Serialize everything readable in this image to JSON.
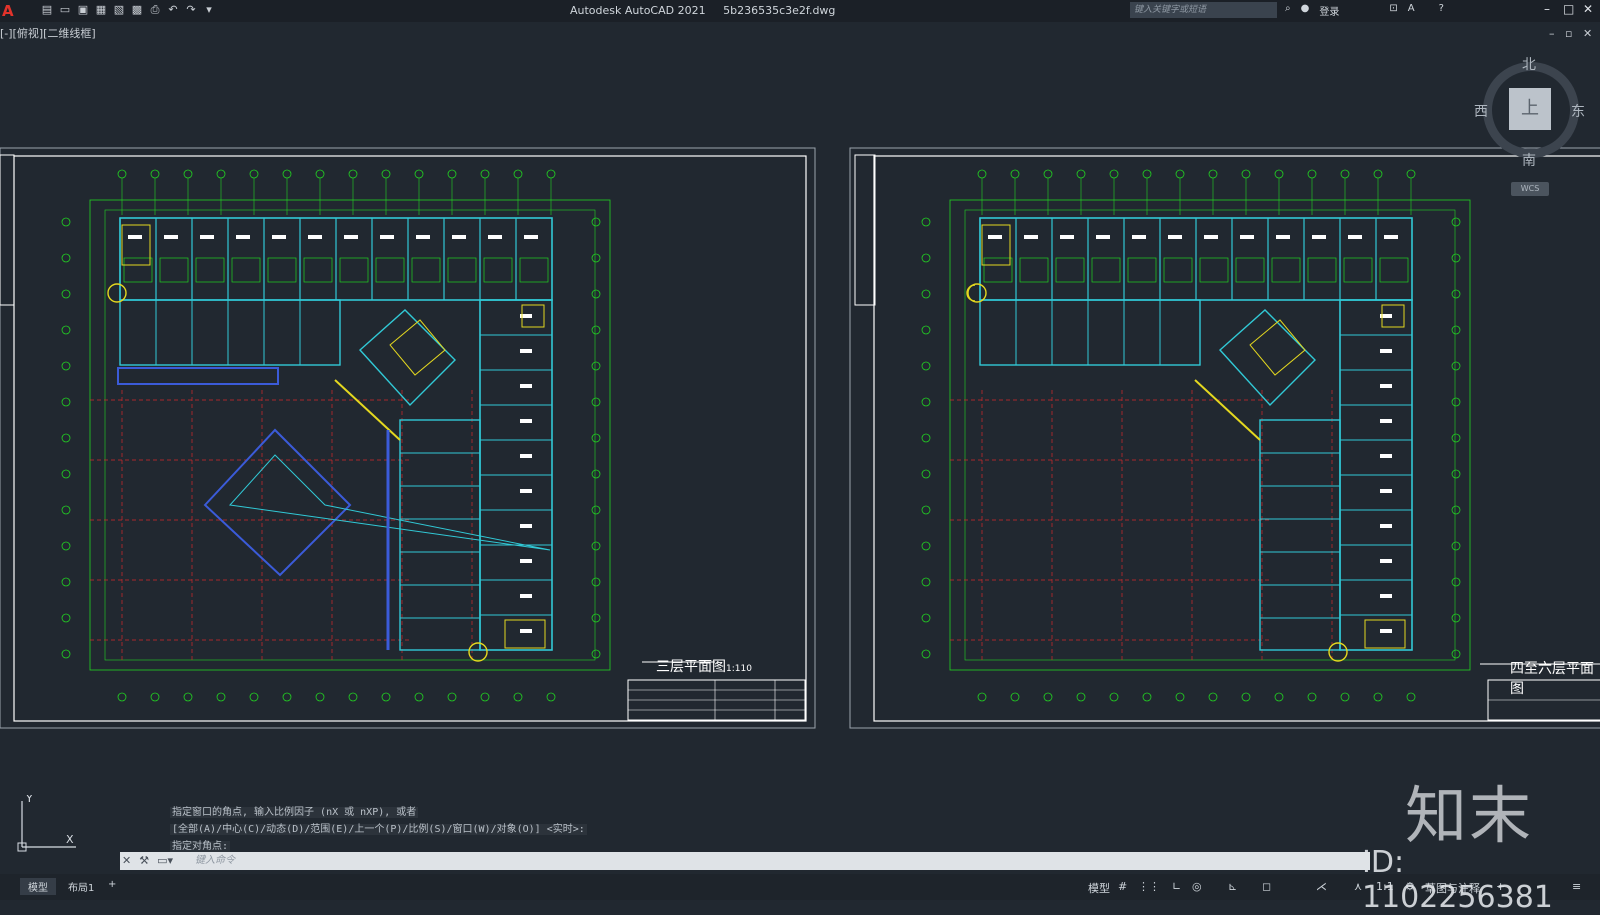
{
  "app": {
    "logo": "A",
    "name": "Autodesk AutoCAD 2021",
    "file": "5b236535c3e2f.dwg"
  },
  "search": {
    "placeholder": "键入关键字或短语"
  },
  "account": {
    "login": "登录"
  },
  "view_label": "[-][俯视][二维线框]",
  "viewcube": {
    "north": "北",
    "south": "南",
    "east": "东",
    "west": "西",
    "face": "上",
    "wcs": "WCS"
  },
  "drawings": [
    {
      "title": "三层平面图",
      "scale": "1:110"
    },
    {
      "title": "四至六层平面图",
      "scale": ""
    }
  ],
  "command_history": [
    "指定窗口的角点, 输入比例因子 (nX 或 nXP), 或者",
    "[全部(A)/中心(C)/动态(D)/范围(E)/上一个(P)/比例(S)/窗口(W)/对象(O)] <实时>:",
    "指定对角点:"
  ],
  "command_input": {
    "placeholder": "键入命令"
  },
  "layout_tabs": [
    "模型",
    "布局1",
    "+"
  ],
  "status": {
    "model": "模型",
    "scale": "1:1",
    "workspace": "草图与注释"
  },
  "watermark": {
    "brand": "知末",
    "id": "ID: 1102256381"
  },
  "colors": {
    "background": "#212830",
    "grid_green": "#22d422",
    "wall_cyan": "#31c9d6",
    "axis_red": "#d42a2a",
    "yellow": "#e4d81f"
  }
}
